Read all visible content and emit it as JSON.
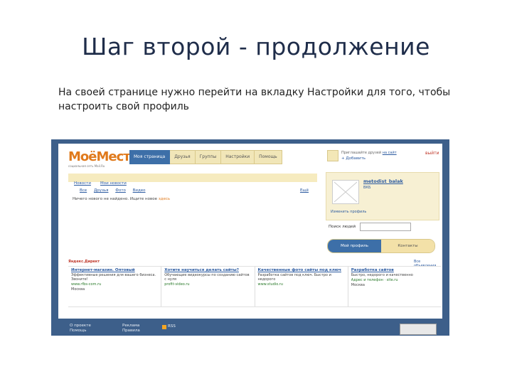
{
  "slide": {
    "title": "Шаг второй - продолжение",
    "text": "На своей странице нужно перейти на вкладку Настройки для того, чтобы настроить свой профиль"
  },
  "site": {
    "logo_main": "Моё",
    "logo_accent": "Место",
    "logo_sub": "социальная сеть Mail.Ru",
    "nav": [
      "Моя страница",
      "Друзья",
      "Группы",
      "Настройки",
      "Помощь"
    ],
    "bar_links": [
      "Новости",
      "Мои новости"
    ],
    "sublinks": [
      "Все",
      "Друзья",
      "Фото",
      "Видео"
    ],
    "sublink_right": "Ещё",
    "notice": "Ничего нового не найдено. Ищите новое",
    "notice_link": "здесь",
    "user_top": {
      "t1": "Приглашайте друзей",
      "t1_link": "на сайт",
      "t2": "+ Добавить",
      "close": "выйти"
    },
    "profile": {
      "name": "metodist_balak",
      "status": "ВКБ",
      "edit": "Изменить профиль"
    },
    "search_label": "Поиск людей",
    "tabs2": [
      "Мой профиль",
      "Контакты"
    ],
    "ads_head": "Яндекс.Директ",
    "ads_right": "Все объявления",
    "ads": [
      {
        "h": "Интернет-магазин. Оптовый",
        "d": "Эффективные решения для вашего бизнеса. Звоните!",
        "u": "www.rfbs-com.ru",
        "c": "Москва"
      },
      {
        "h": "Хотите научиться делать сайты?",
        "d": "Обучающие видеокурсы по созданию сайтов с нуля",
        "u": "profit-video.ru",
        "c": ""
      },
      {
        "h": "Качественные фото сайты под ключ",
        "d": "Разработка сайтов под ключ. Быстро и недорого",
        "u": "www.studio.ru",
        "c": ""
      },
      {
        "h": "Разработка сайтов",
        "d": "Быстро, недорого и качественно",
        "u": "Адрес и телефон · site.ru",
        "c": "Москва"
      }
    ],
    "footer": [
      "О проекте",
      "Помощь",
      "Реклама",
      "Правила",
      "RSS"
    ]
  }
}
